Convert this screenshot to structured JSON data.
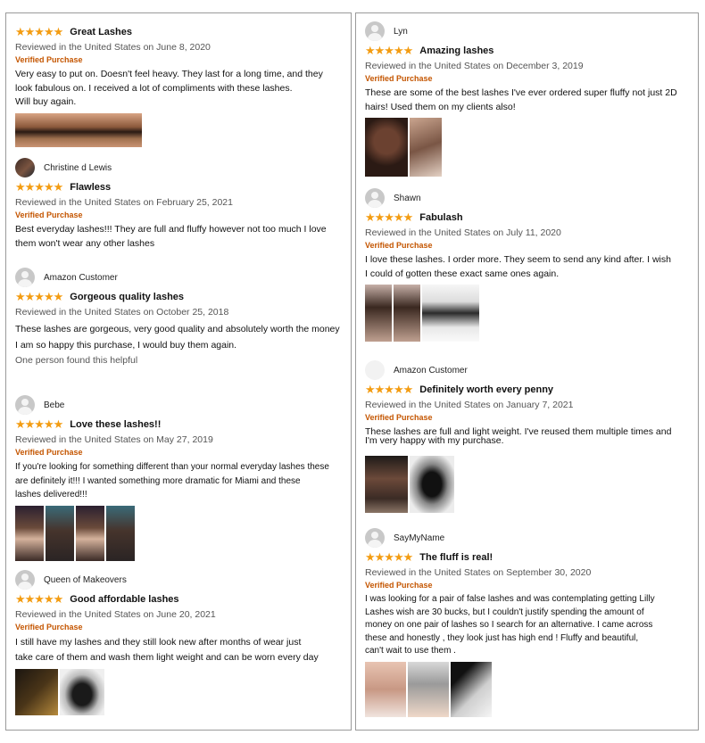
{
  "left_reviews": [
    {
      "username": "",
      "stars": "★★★★★",
      "title": "Great Lashes",
      "date": "Reviewed in the United States on June 8, 2020",
      "verified": "Verified Purchase",
      "body_lines": [
        "Very easy to put on. Doesn't feel heavy. They last for a long time, and they",
        "look fabulous on. I received a lot of compliments with these lashes.",
        "Will buy again."
      ]
    },
    {
      "username": "Christine d Lewis",
      "stars": "★★★★★",
      "title": "Flawless",
      "date": "Reviewed in the United States on February 25, 2021",
      "verified": "Verified Purchase",
      "body_lines": [
        "Best everyday lashes!!! They are full and fluffy however not too much I love",
        "them won't wear any other lashes"
      ]
    },
    {
      "username": "Amazon Customer",
      "stars": "★★★★★",
      "title": "Gorgeous quality lashes",
      "date": "Reviewed in the United States on October 25, 2018",
      "verified": "",
      "body_lines": [
        "These lashes are gorgeous, very good quality and absolutely worth the money",
        "I am so happy this purchase, I would buy them again."
      ],
      "helpful": "One person found this helpful"
    },
    {
      "username": "Bebe",
      "stars": "★★★★★",
      "title": "Love these lashes!!",
      "date": "Reviewed in the United States on May 27, 2019",
      "verified": "Verified Purchase",
      "body_lines": [
        "If you're looking for something different than your normal everyday lashes these",
        "are definitely it!!! I wanted something more dramatic for Miami and these",
        "lashes delivered!!!"
      ]
    },
    {
      "username": "Queen of Makeovers",
      "stars": "★★★★★",
      "title": "Good affordable lashes",
      "date": "Reviewed in the United States on June 20, 2021",
      "verified": "Verified Purchase",
      "body_lines": [
        "I still have my lashes and they still look new after months of wear just",
        "take care of them and wash them light weight and can be worn every day"
      ]
    }
  ],
  "right_reviews": [
    {
      "username": "Lyn",
      "stars": "★★★★★",
      "title": "Amazing lashes",
      "date": "Reviewed in the United States on December 3, 2019",
      "verified": "Verified Purchase",
      "body_lines": [
        "These are some of the best lashes I've ever ordered super fluffy not just 2D",
        "hairs! Used them on my clients also!"
      ]
    },
    {
      "username": "Shawn",
      "stars": "★★★★★",
      "title": "Fabulash",
      "date": "Reviewed in the United States on July 11, 2020",
      "verified": "Verified Purchase",
      "body_lines": [
        "I love these lashes. I order more. They seem to send any kind after. I wish",
        "I could of gotten these exact same ones again."
      ]
    },
    {
      "username": "Amazon Customer",
      "stars": "★★★★★",
      "title": "Definitely worth every penny",
      "date": "Reviewed in the United States on January 7, 2021",
      "verified": "Verified Purchase",
      "body_lines": [
        "These lashes are full and light weight. I've reused them multiple times and",
        "I'm very happy with my purchase."
      ]
    },
    {
      "username": "SayMyName",
      "stars": "★★★★★",
      "title": "The fluff is real!",
      "date": "Reviewed in the United States on September 30, 2020",
      "verified": "Verified Purchase",
      "body_lines": [
        "I was looking for a pair of false lashes and was contemplating getting Lilly",
        "Lashes wish are 30 bucks, but I couldn't justify spending the amount of",
        "money on one pair of lashes  so I search for an alternative. I came across",
        "these and honestly , they look just has high end ! Fluffy and beautiful,",
        "can't wait to use them ."
      ]
    }
  ],
  "colors": {
    "star": "#f39c12",
    "verified": "#c45500",
    "border": "#9a9a9a"
  },
  "icons": {
    "avatar": "user-avatar-icon",
    "star": "star-rating-icon"
  }
}
